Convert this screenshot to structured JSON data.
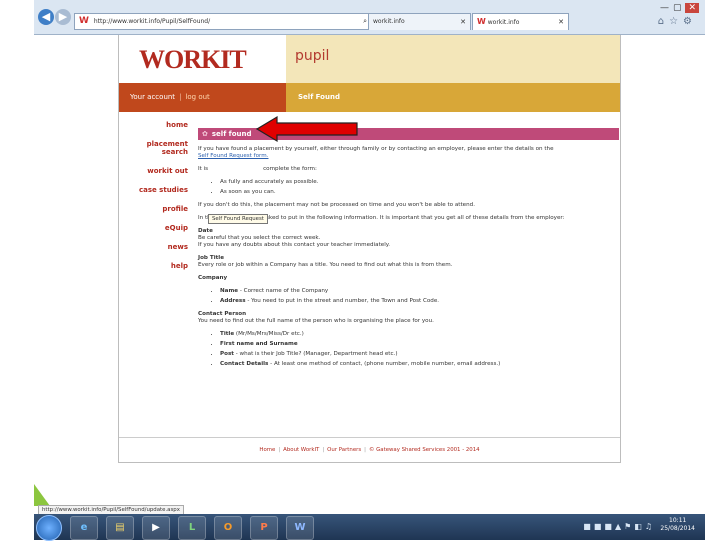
{
  "browser": {
    "url": "http://www.workit.info/Pupil/SelfFound/",
    "tab1_title": "workit.info",
    "tab2_title": "workit.info",
    "window_controls": "— ▢ ✕",
    "status_url": "http://www.workit.info/Pupil/SelfFound/update.aspx"
  },
  "site": {
    "logo_part1": "WORK",
    "logo_part2": "IT",
    "section_name": "pupil",
    "account_label": "Your account",
    "logout_label": "log out",
    "breadcrumb": "Self Found"
  },
  "sidenav": [
    "home",
    "placement",
    "search",
    "workit out",
    "case studies",
    "profile",
    "eQuip",
    "news",
    "help"
  ],
  "content": {
    "heading": "self found",
    "intro": "If you have found a placement by yourself, either through family or by contacting an employer, please enter the details on the",
    "form_link": "Self Found Request form.",
    "tooltip": "Self Found Request",
    "complete_prefix": "It is",
    "complete_suffix": "complete the form:",
    "complete_items": [
      "As fully and accurately as possible.",
      "As soon as you can."
    ],
    "warning": "If you don't do this, the placement may not be processed on time and you won't be able to attend.",
    "details_intro": "In the form you will be asked to put in the following information. It is important that you get all of these details from the employer:",
    "date_heading": "Date",
    "date_text1": "Be careful that you select the correct week.",
    "date_text2": "If you have any doubts about this contact your teacher immediately.",
    "job_heading": "Job Title",
    "job_text": "Every role or job within a Company has a title. You need to find out what this is from them.",
    "company_heading": "Company",
    "company_items": [
      {
        "label": "Name",
        "text": " - Correct name of the Company"
      },
      {
        "label": "Address",
        "text": " - You need to put in the street and number, the Town and Post Code."
      }
    ],
    "contact_heading": "Contact Person",
    "contact_text": "You need to find out the full name of the person who is organising the place for you.",
    "contact_items": [
      {
        "label": "Title",
        "text": " (Mr/Ms/Mrs/Miss/Dr etc.)"
      },
      {
        "label": "First name and Surname",
        "text": ""
      },
      {
        "label": "Post",
        "text": " - what is their Job Title? (Manager, Department head etc.)"
      },
      {
        "label": "Contact Details",
        "text": " - At least one method of contact, (phone number, mobile number, email address.)"
      }
    ]
  },
  "footer": {
    "links": [
      "Home",
      "About WorkIT",
      "Our Partners"
    ],
    "copyright": "© Gateway Shared Services 2001 - 2014"
  },
  "taskbar": {
    "apps": [
      "e",
      "▤",
      "▶",
      "L",
      "O",
      "P",
      "W"
    ],
    "time": "10:11",
    "date": "25/08/2014"
  },
  "colors": {
    "brand_red": "#b22a1f",
    "account_bar": "#c0481c",
    "crumb_bar": "#d8a738",
    "section_head": "#bf4a79",
    "arrow": "#e00000"
  }
}
